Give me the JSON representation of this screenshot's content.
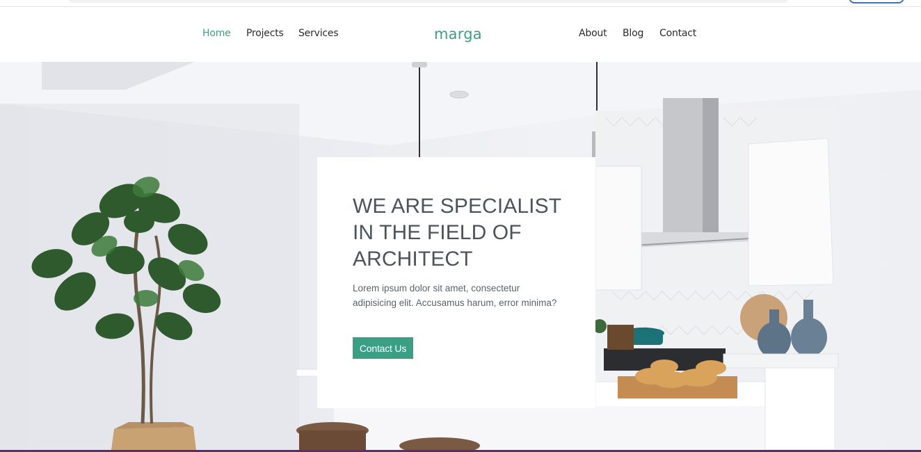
{
  "nav": {
    "left_links": [
      {
        "label": "Home",
        "active": true
      },
      {
        "label": "Projects",
        "active": false
      },
      {
        "label": "Services",
        "active": false
      }
    ],
    "brand": "marga",
    "right_links": [
      {
        "label": "About"
      },
      {
        "label": "Blog"
      },
      {
        "label": "Contact"
      }
    ]
  },
  "hero": {
    "heading": "WE ARE SPECIALIST IN THE FIELD OF ARCHITECT",
    "body": "Lorem ipsum dolor sit amet, consectetur adipisicing elit. Accusamus harum, error minima?",
    "cta_label": "Contact Us"
  },
  "colors": {
    "accent": "#3a9f84",
    "heading": "#4a555b",
    "body_text": "#5a6368",
    "nav_text": "#2b2b2b"
  }
}
